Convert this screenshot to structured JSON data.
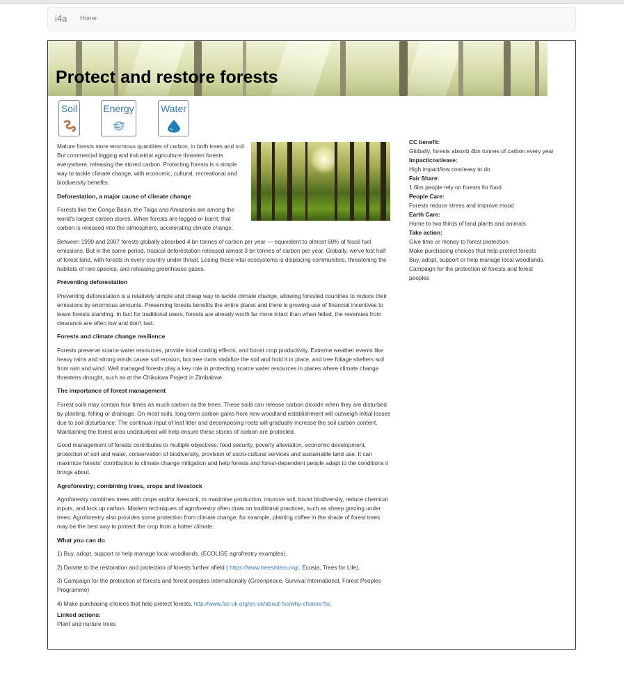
{
  "navbar": {
    "brand": "i4a",
    "home": "Home"
  },
  "page": {
    "title": "Protect and restore forests"
  },
  "categories": [
    {
      "label": "Soil"
    },
    {
      "label": "Energy"
    },
    {
      "label": "Water"
    }
  ],
  "article": {
    "intro": "Mature forests store enormous quantities of carbon, in both trees and soil. But commercial logging and industrial agriculture threaten forests everywhere, releasing the stored carbon. Protecting forests is a simple way to tackle climate change, with economic, cultural, recreational and biodiversity benefits.",
    "h_deforestation": "Deforestation, a major cause of climate change",
    "p_deforestation_1": "Forests like the Congo Basin, the Taiga and Amazonia are among the world's largest carbon stores. When forests are logged or burnt, that carbon is released into the atmosphere, accelerating climate change.",
    "p_deforestation_2": "Between 1990 and 2007 forests globally absorbed 4 bn tonnes of carbon per year — equivalent to almost 60% of fossil fuel emissions. But in the same period, tropical deforestation released almost 3 bn tonnes of carbon per year. Globally, we've lost half of forest land, with forests in every country under threat. Losing these vital ecosystems is displacing communities, threatening the habitats of rare species, and releasing greenhouse gases.",
    "h_preventing": "Preventing deforestation",
    "p_preventing": "Preventing deforestation is a relatively simple and cheap way to tackle climate change, allowing forested countries to reduce their emissions by enormous amounts. Preserving forests benefits the entire planet and there is growing use of financial incentives to leave forests standing. In fact for traditional users, forests are already worth far more intact than when felled, the revenues from clearance are often low and don't last.",
    "h_resilience": "Forests and climate change resilience",
    "p_resilience": "Forests preserve scarce water resources, provide local cooling effects, and boost crop productivity. Extreme weather events like heavy rains and strong winds cause soil erosion, but tree roots stabilize the soil and hold it in place, and tree foliage shelters soil from rain and wind. Well managed forests play a key role in protecting scarce water resources in places where climate change threatens drought, such as at the Chikukwa Project in Zimbabwe.",
    "h_management": "The importance of forest management",
    "p_management_1": "Forest soils may contain four times as much carbon as the trees. These soils can release carbon dioxide when they are disturbed by planting, felling or drainage. On most soils, long-term carbon gains from new woodland establishment will outweigh initial losses due to soil disturbance. The continual input of leaf litter and decomposing roots will gradually increase the soil carbon content. Maintaining the forest area undisturbed will help ensure these stocks of carbon are protected.",
    "p_management_2": "Good management of forests contributes to multiple objectives: food security, poverty alleviation, economic development, protection of soil and water, conservation of biodiversity, provision of socio-cultural services and sustainable land use. It can maximize forests' contribution to climate change mitigation and help forests and forest-dependent people adapt to the conditions it brings about.",
    "h_agroforestry": "Agroforestry; combining trees, crops and livestock",
    "p_agroforestry": "Agroforestry combines trees with crops and/or livestock, to maximise production, improve soil, boost biodiversity, reduce chemical inputs, and lock up carbon. Modern techniques of agroforestry often draw on traditional practices, such as sheep grazing under trees. Agroforestry also provides some protection from climate change; for example, planting coffee in the shade of forest trees may be the best way to protect the crop from a hotter climate.",
    "h_whatyoucando": "What you can do",
    "action_1": "1) Buy, adopt, support or help manage local woodlands. (ECOLISE agrofrestry examples).",
    "action_2_pre": "2) Donate to the restoration and protection of forests further afield ( ",
    "action_2_link": "https://www.treesisters.org/",
    "action_2_post": ", Ecosia, Trees for Life).",
    "action_3": "3) Campaign for the protection of forests and forest peoples internationally (Greenpeace, Survival International, Forest Peoples Programme)",
    "action_4_pre": "4) Make purchasing choices that help protect forests. ",
    "action_4_link": "http://www.fsc-uk.org/en-uk/about-fsc/why-choose-fsc",
    "linked_label": "Linked actions:",
    "linked_value": "Plant and nurture trees"
  },
  "sidebar": {
    "cc_benefit_label": "CC benefit:",
    "cc_benefit": "Globally, forests absorb 4bn tonnes of carbon every year",
    "impact_label": "Impact/cost/ease:",
    "impact": "High impact/low cost/easy to do",
    "fair_share_label": "Fair Share:",
    "fair_share": "1.6bn people rely on forests for food",
    "people_care_label": "People Care:",
    "people_care": "Forests reduce stress and improve mood",
    "earth_care_label": "Earth Care:",
    "earth_care": "Home to two thirds of land plants and animals",
    "take_action_label": "Take action:",
    "take_actions": [
      "Give time or money to forest protection",
      "Make purchasing choices that help protect forests",
      "Buy, adopt, support or help manage local woodlands.",
      "Campaign for the protection of forests and forest",
      "peoples"
    ]
  },
  "colors": {
    "link": "#337ab7",
    "nav_bg": "#f8f8f8"
  },
  "icons": {
    "soil": "worm-icon",
    "energy": "wind-icon",
    "water": "water-drop-icon"
  }
}
